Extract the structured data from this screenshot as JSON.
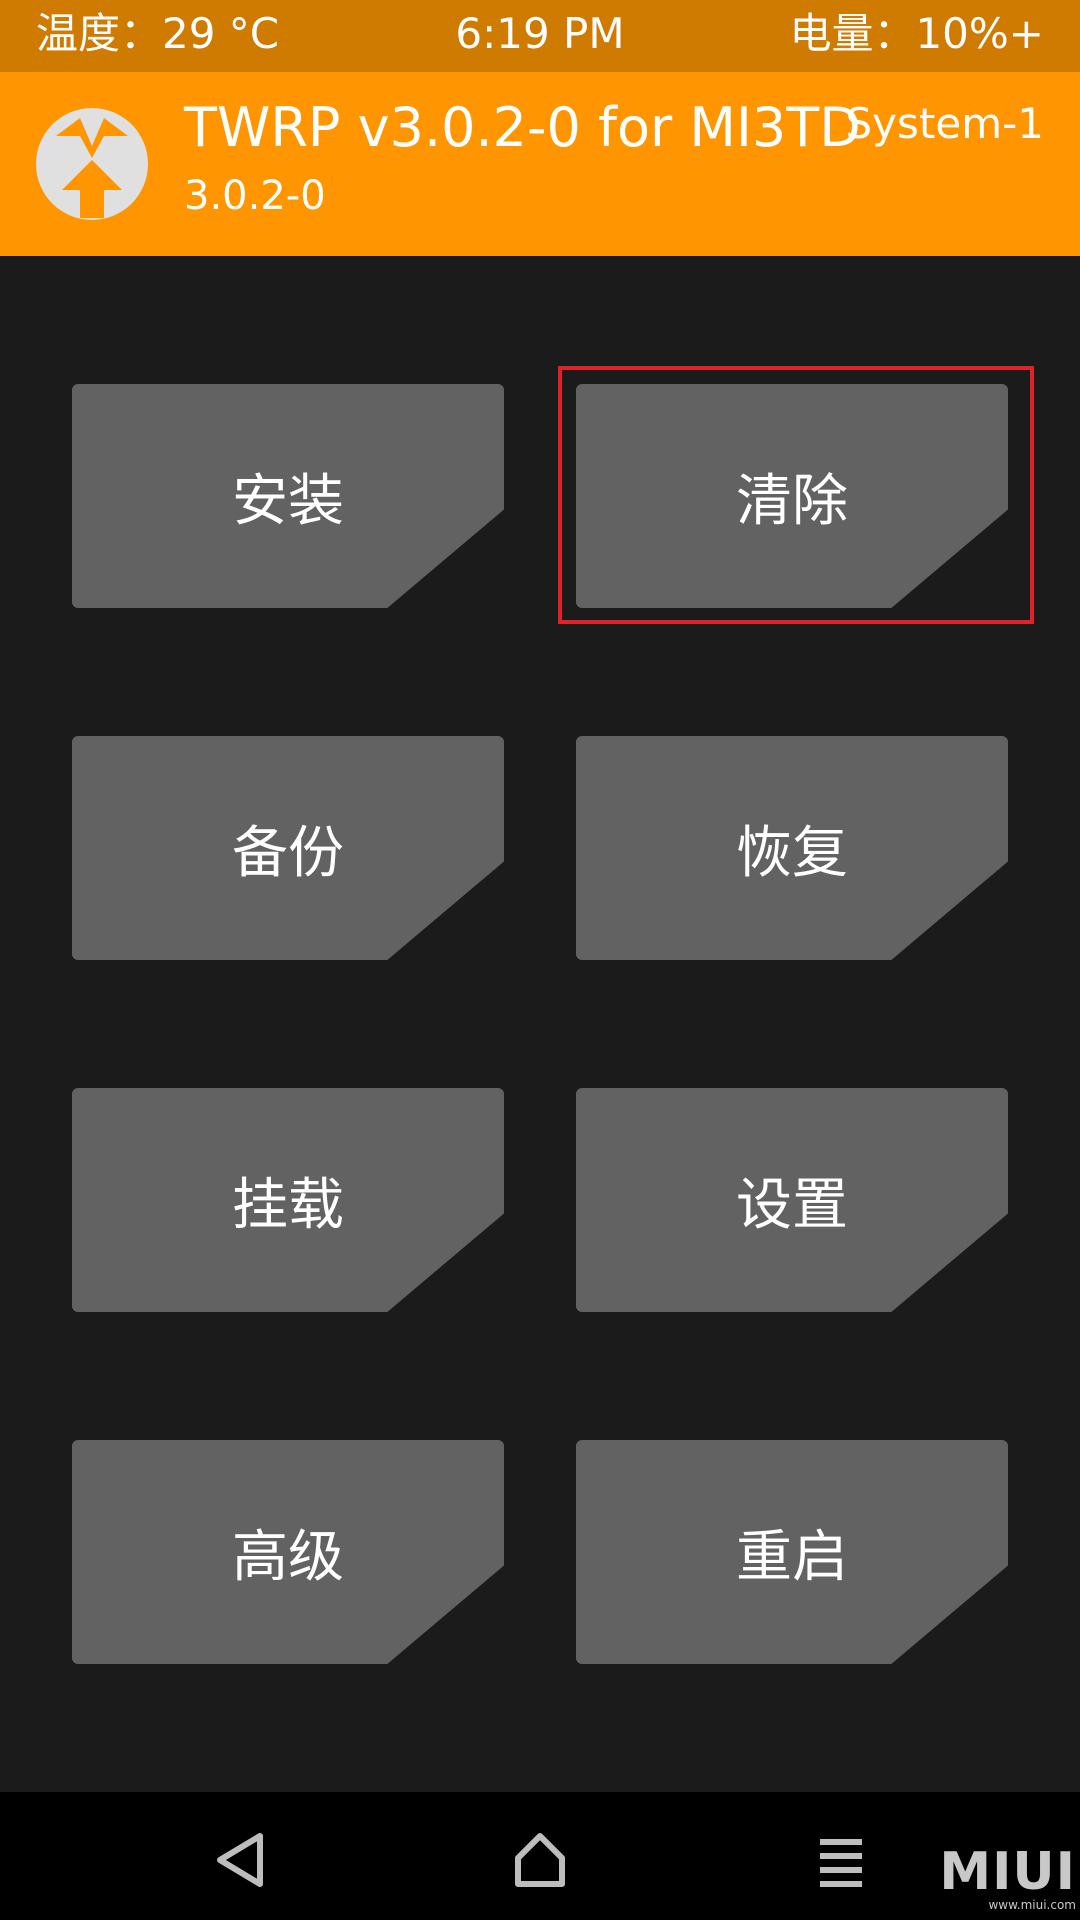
{
  "status_bar": {
    "temperature": "温度：29 °C",
    "time": "6:19 PM",
    "battery": "电量：10%+"
  },
  "header": {
    "title": "TWRP v3.0.2-0 for MI3TD",
    "version": "3.0.2-0",
    "slot": "System-1"
  },
  "menu": {
    "install": "安装",
    "wipe": "清除",
    "backup": "备份",
    "restore": "恢复",
    "mount": "挂载",
    "settings": "设置",
    "advanced": "高级",
    "reboot": "重启"
  },
  "watermark": {
    "logo": "MIUI",
    "url": "www.miui.com"
  },
  "colors": {
    "status_bar": "#cf7a00",
    "header": "#ff9500",
    "background": "#1b1b1b",
    "tile": "#626262",
    "highlight": "#e0232b",
    "nav_bar": "#000000"
  }
}
